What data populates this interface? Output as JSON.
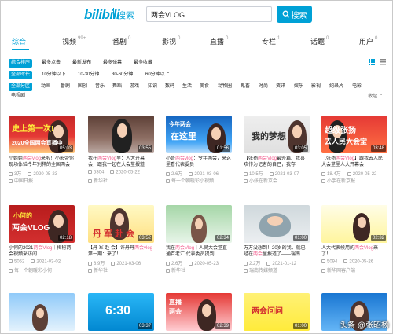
{
  "logo": {
    "brand": "bilibili",
    "sub": "搜索"
  },
  "search": {
    "value": "两会VLOG",
    "button": "搜索"
  },
  "tabs": [
    {
      "label": "综合",
      "count": ""
    },
    {
      "label": "视频",
      "count": "99+"
    },
    {
      "label": "番剧",
      "count": "0"
    },
    {
      "label": "影视",
      "count": "0"
    },
    {
      "label": "直播",
      "count": "0"
    },
    {
      "label": "专栏",
      "count": "1"
    },
    {
      "label": "话题",
      "count": "0"
    },
    {
      "label": "用户",
      "count": "0"
    }
  ],
  "filters": {
    "order": [
      "综合排序",
      "最多点击",
      "最新发布",
      "最多弹幕",
      "最多收藏"
    ],
    "duration": [
      "全部时长",
      "10分钟以下",
      "10-30分钟",
      "30-60分钟",
      "60分钟以上"
    ],
    "zones": [
      "全部分区",
      "动画",
      "番剧",
      "国创",
      "音乐",
      "舞蹈",
      "游戏",
      "知识",
      "数码",
      "生活",
      "美食",
      "动物圈",
      "鬼畜",
      "时尚",
      "资讯",
      "娱乐",
      "影视",
      "纪录片",
      "电影",
      "电视剧"
    ],
    "collapse": "收起 ⌃"
  },
  "videos": [
    {
      "thumb_text": "史上第一次!",
      "thumb_text2": "2020全国两会直播中",
      "duration": "05:03",
      "title_pre": "小姐姐",
      "title_hl": "两会vlog",
      "title_post": "来啦！小影带你现场体验今年别样的全国两会",
      "views": "3万",
      "date": "2020-05-23",
      "author": "中国日报"
    },
    {
      "thumb_text": "",
      "thumb_text2": "",
      "duration": "03:55",
      "title_pre": "我在",
      "title_hl": "两会Vlog",
      "title_post": "里：人大开幕会，跟我一起在大会堂报道",
      "views": "5304",
      "date": "2020-05-22",
      "author": "新华社"
    },
    {
      "thumb_text": "今年两会",
      "thumb_text2": "在这里",
      "duration": "01:56",
      "title_pre": "小哥",
      "title_hl": "两会vlog",
      "title_post": "：今年两会，来这里看代表委员",
      "views": "2.6万",
      "date": "2021-03-06",
      "author": "每一个朝暖彩小视频"
    },
    {
      "thumb_text": "我的梦想",
      "thumb_text2": "",
      "duration": "03:05",
      "title_pre": "【张扬",
      "title_hl": "两会Vlog",
      "title_post": "最外篇】我喜欢作为记者的自己，我存",
      "views": "10.5万",
      "date": "2021-03-07",
      "author": "小张在新京会"
    },
    {
      "thumb_text": "超级张扬",
      "thumb_text2": "去人民大会堂",
      "duration": "03:48",
      "title_pre": "【张扬",
      "title_hl": "两会Vlog",
      "title_post": "】跟我去人民大会堂里人大开幕会",
      "views": "18.4万",
      "date": "2020-05-22",
      "author": "小手在新京报"
    },
    {
      "thumb_text": "小何的",
      "thumb_text2": "两会VLOG",
      "duration": "02:18",
      "title_pre": "小何的2021",
      "title_hl": "两会Vlog",
      "title_post": "｜揭秘两会视频采访间",
      "views": "5052",
      "date": "2021-03-02",
      "author": "每一个朝暖彩小何"
    },
    {
      "thumb_text": "丹 军 赴 会",
      "thumb_text2": "",
      "duration": "03:52",
      "title_pre": "【丹 军 赴 会】许丹丹",
      "title_hl": "两会vlog",
      "title_post": "第一期：来了！",
      "views": "8.9万",
      "date": "2021-03-06",
      "author": "新华社"
    },
    {
      "thumb_text": "",
      "thumb_text2": "",
      "duration": "02:34",
      "title_pre": "我在",
      "title_hl": "两会Vlog",
      "title_post": "｜人民大会堂直通百老汇 代表委员提到",
      "views": "2.6万",
      "date": "2020-05-23",
      "author": "新华社"
    },
    {
      "thumb_text": "",
      "thumb_text2": "",
      "duration": "01:00",
      "title_pre": "万万没想到！20岁的我，就已经在",
      "title_hl": "两会",
      "title_post": "里报道了——瑞南",
      "views": "2.2万",
      "date": "2021-01-12",
      "author": "瑞南传媒频道"
    },
    {
      "thumb_text": "",
      "thumb_text2": "",
      "duration": "02:32",
      "title_pre": "人大代表候用的",
      "title_hl": "两会Vlog",
      "title_post": "来了！",
      "views": "5094",
      "date": "2020-05-26",
      "author": "新华网客户端"
    },
    {
      "thumb_text": "",
      "thumb_text2": "",
      "duration": "",
      "title_pre": "",
      "title_hl": "",
      "title_post": "",
      "views": "",
      "date": "",
      "author": ""
    },
    {
      "thumb_text": "6:30",
      "thumb_text2": "",
      "duration": "03:37",
      "title_pre": "",
      "title_hl": "",
      "title_post": "",
      "views": "",
      "date": "",
      "author": ""
    },
    {
      "thumb_text": "直播",
      "thumb_text2": "两会",
      "duration": "02:39",
      "title_pre": "",
      "title_hl": "",
      "title_post": "",
      "views": "",
      "date": "",
      "author": ""
    },
    {
      "thumb_text": "两会问问",
      "thumb_text2": "",
      "duration": "01:00",
      "title_pre": "",
      "title_hl": "",
      "title_post": "",
      "views": "",
      "date": "",
      "author": ""
    },
    {
      "thumb_text": "",
      "thumb_text2": "",
      "duration": "",
      "title_pre": "",
      "title_hl": "",
      "title_post": "",
      "views": "",
      "date": "",
      "author": ""
    }
  ],
  "watermark": "头条 @张昭杨",
  "colors": {
    "accent": "#00a1d6",
    "highlight": "#f25d8e"
  }
}
